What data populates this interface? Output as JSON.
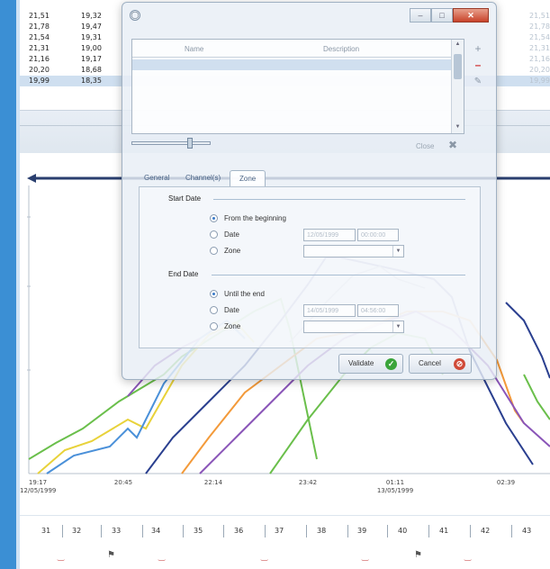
{
  "background_table": {
    "rows": [
      {
        "c1": "21,51",
        "c2": "19,32",
        "c3": "21,51"
      },
      {
        "c1": "21,78",
        "c2": "19,47",
        "c3": "21,78"
      },
      {
        "c1": "21,54",
        "c2": "19,31",
        "c3": "21,54"
      },
      {
        "c1": "21,31",
        "c2": "19,00",
        "c3": "21,31"
      },
      {
        "c1": "21,16",
        "c2": "19,17",
        "c3": "21,16"
      },
      {
        "c1": "20,20",
        "c2": "18,68",
        "c3": "20,20"
      },
      {
        "c1": "19,99",
        "c2": "18,35",
        "c3": "19,99"
      }
    ]
  },
  "chart": {
    "time_labels": [
      {
        "time": "19:17",
        "date": "12/05/1999"
      },
      {
        "time": "20:45",
        "date": ""
      },
      {
        "time": "22:14",
        "date": ""
      },
      {
        "time": "23:42",
        "date": ""
      },
      {
        "time": "01:11",
        "date": "13/05/1999"
      },
      {
        "time": "02:39",
        "date": ""
      }
    ],
    "colors": {
      "green": "#6abf4b",
      "blue": "#4a90d9",
      "navy": "#2a3f8f",
      "purple": "#8a55b8",
      "orange": "#f39a3a",
      "yellow": "#e8d23a",
      "gray": "#9aa4b0"
    }
  },
  "strip": {
    "numbers": [
      "31",
      "32",
      "33",
      "34",
      "35",
      "36",
      "37",
      "38",
      "39",
      "40",
      "41",
      "42",
      "43"
    ]
  },
  "dialog": {
    "list_columns": {
      "name": "Name",
      "description": "Description"
    },
    "close_label": "Close",
    "tabs": [
      "General",
      "Channel(s)",
      "Zone"
    ],
    "start_group": {
      "label": "Start Date",
      "opt_beginning": "From the beginning",
      "opt_date": "Date",
      "opt_zone": "Zone",
      "date_value": "12/05/1999",
      "time_value": "00:00:00"
    },
    "end_group": {
      "label": "End Date",
      "opt_end": "Until the end",
      "opt_date": "Date",
      "opt_zone": "Zone",
      "date_value": "14/05/1999",
      "time_value": "04:56:00"
    },
    "validate_label": "Validate",
    "cancel_label": "Cancel"
  }
}
